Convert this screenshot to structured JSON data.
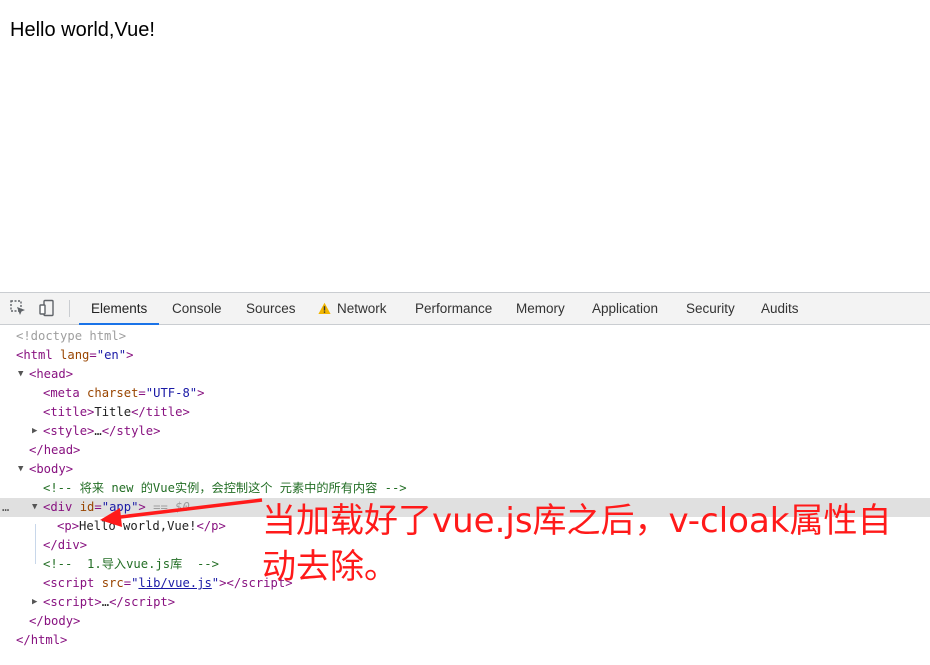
{
  "page": {
    "text": "Hello world,Vue!"
  },
  "devtools": {
    "tabs": [
      "Elements",
      "Console",
      "Sources",
      "Network",
      "Performance",
      "Memory",
      "Application",
      "Security",
      "Audits"
    ],
    "active_tab": "Elements",
    "icons": [
      "inspect-element-icon",
      "device-toolbar-icon",
      "network-warning-icon"
    ]
  },
  "dom": {
    "doctype": "<!doctype html>",
    "html_open_tag": "html",
    "html_attr": "lang",
    "html_attr_val": "\"en\"",
    "head": "head",
    "meta_tag": "meta",
    "meta_attr": "charset",
    "meta_val": "\"UTF-8\"",
    "title_tag": "title",
    "title_text": "Title",
    "style_tag": "style",
    "ellipsis": "…",
    "body": "body",
    "comment1": "<!-- 将来 new 的Vue实例，会控制这个 元素中的所有内容 -->",
    "div_tag": "div",
    "div_attr": "id",
    "div_val": "\"app\"",
    "selected_marker": "== $0",
    "p_tag": "p",
    "p_text": "Hello world,Vue!",
    "comment2": "<!--  1.导入vue.js库  -->",
    "script_tag": "script",
    "script_attr": "src",
    "script_src": "lib/vue.js",
    "row_dots": "…"
  },
  "annotation": {
    "text": "当加载好了vue.js库之后，v-cloak属性自动去除。",
    "color": "#ff1a1a"
  }
}
